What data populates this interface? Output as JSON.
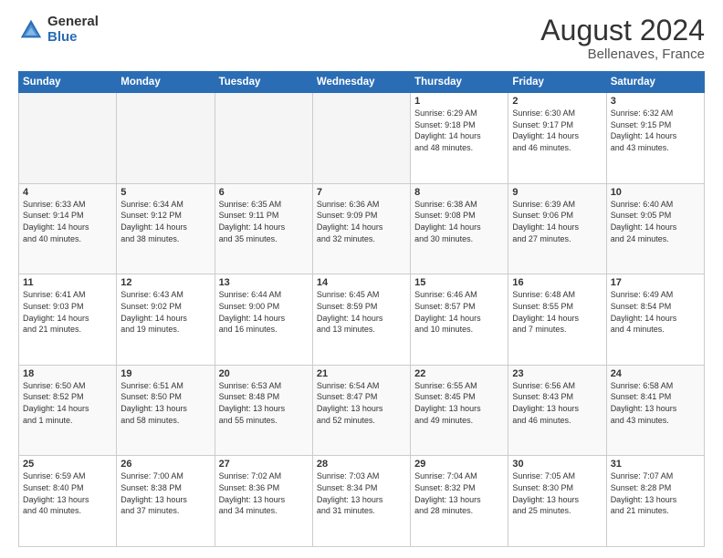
{
  "header": {
    "logo_general": "General",
    "logo_blue": "Blue",
    "title": "August 2024",
    "location": "Bellenaves, France"
  },
  "days_of_week": [
    "Sunday",
    "Monday",
    "Tuesday",
    "Wednesday",
    "Thursday",
    "Friday",
    "Saturday"
  ],
  "weeks": [
    [
      {
        "day": "",
        "info": ""
      },
      {
        "day": "",
        "info": ""
      },
      {
        "day": "",
        "info": ""
      },
      {
        "day": "",
        "info": ""
      },
      {
        "day": "1",
        "info": "Sunrise: 6:29 AM\nSunset: 9:18 PM\nDaylight: 14 hours\nand 48 minutes."
      },
      {
        "day": "2",
        "info": "Sunrise: 6:30 AM\nSunset: 9:17 PM\nDaylight: 14 hours\nand 46 minutes."
      },
      {
        "day": "3",
        "info": "Sunrise: 6:32 AM\nSunset: 9:15 PM\nDaylight: 14 hours\nand 43 minutes."
      }
    ],
    [
      {
        "day": "4",
        "info": "Sunrise: 6:33 AM\nSunset: 9:14 PM\nDaylight: 14 hours\nand 40 minutes."
      },
      {
        "day": "5",
        "info": "Sunrise: 6:34 AM\nSunset: 9:12 PM\nDaylight: 14 hours\nand 38 minutes."
      },
      {
        "day": "6",
        "info": "Sunrise: 6:35 AM\nSunset: 9:11 PM\nDaylight: 14 hours\nand 35 minutes."
      },
      {
        "day": "7",
        "info": "Sunrise: 6:36 AM\nSunset: 9:09 PM\nDaylight: 14 hours\nand 32 minutes."
      },
      {
        "day": "8",
        "info": "Sunrise: 6:38 AM\nSunset: 9:08 PM\nDaylight: 14 hours\nand 30 minutes."
      },
      {
        "day": "9",
        "info": "Sunrise: 6:39 AM\nSunset: 9:06 PM\nDaylight: 14 hours\nand 27 minutes."
      },
      {
        "day": "10",
        "info": "Sunrise: 6:40 AM\nSunset: 9:05 PM\nDaylight: 14 hours\nand 24 minutes."
      }
    ],
    [
      {
        "day": "11",
        "info": "Sunrise: 6:41 AM\nSunset: 9:03 PM\nDaylight: 14 hours\nand 21 minutes."
      },
      {
        "day": "12",
        "info": "Sunrise: 6:43 AM\nSunset: 9:02 PM\nDaylight: 14 hours\nand 19 minutes."
      },
      {
        "day": "13",
        "info": "Sunrise: 6:44 AM\nSunset: 9:00 PM\nDaylight: 14 hours\nand 16 minutes."
      },
      {
        "day": "14",
        "info": "Sunrise: 6:45 AM\nSunset: 8:59 PM\nDaylight: 14 hours\nand 13 minutes."
      },
      {
        "day": "15",
        "info": "Sunrise: 6:46 AM\nSunset: 8:57 PM\nDaylight: 14 hours\nand 10 minutes."
      },
      {
        "day": "16",
        "info": "Sunrise: 6:48 AM\nSunset: 8:55 PM\nDaylight: 14 hours\nand 7 minutes."
      },
      {
        "day": "17",
        "info": "Sunrise: 6:49 AM\nSunset: 8:54 PM\nDaylight: 14 hours\nand 4 minutes."
      }
    ],
    [
      {
        "day": "18",
        "info": "Sunrise: 6:50 AM\nSunset: 8:52 PM\nDaylight: 14 hours\nand 1 minute."
      },
      {
        "day": "19",
        "info": "Sunrise: 6:51 AM\nSunset: 8:50 PM\nDaylight: 13 hours\nand 58 minutes."
      },
      {
        "day": "20",
        "info": "Sunrise: 6:53 AM\nSunset: 8:48 PM\nDaylight: 13 hours\nand 55 minutes."
      },
      {
        "day": "21",
        "info": "Sunrise: 6:54 AM\nSunset: 8:47 PM\nDaylight: 13 hours\nand 52 minutes."
      },
      {
        "day": "22",
        "info": "Sunrise: 6:55 AM\nSunset: 8:45 PM\nDaylight: 13 hours\nand 49 minutes."
      },
      {
        "day": "23",
        "info": "Sunrise: 6:56 AM\nSunset: 8:43 PM\nDaylight: 13 hours\nand 46 minutes."
      },
      {
        "day": "24",
        "info": "Sunrise: 6:58 AM\nSunset: 8:41 PM\nDaylight: 13 hours\nand 43 minutes."
      }
    ],
    [
      {
        "day": "25",
        "info": "Sunrise: 6:59 AM\nSunset: 8:40 PM\nDaylight: 13 hours\nand 40 minutes."
      },
      {
        "day": "26",
        "info": "Sunrise: 7:00 AM\nSunset: 8:38 PM\nDaylight: 13 hours\nand 37 minutes."
      },
      {
        "day": "27",
        "info": "Sunrise: 7:02 AM\nSunset: 8:36 PM\nDaylight: 13 hours\nand 34 minutes."
      },
      {
        "day": "28",
        "info": "Sunrise: 7:03 AM\nSunset: 8:34 PM\nDaylight: 13 hours\nand 31 minutes."
      },
      {
        "day": "29",
        "info": "Sunrise: 7:04 AM\nSunset: 8:32 PM\nDaylight: 13 hours\nand 28 minutes."
      },
      {
        "day": "30",
        "info": "Sunrise: 7:05 AM\nSunset: 8:30 PM\nDaylight: 13 hours\nand 25 minutes."
      },
      {
        "day": "31",
        "info": "Sunrise: 7:07 AM\nSunset: 8:28 PM\nDaylight: 13 hours\nand 21 minutes."
      }
    ]
  ]
}
